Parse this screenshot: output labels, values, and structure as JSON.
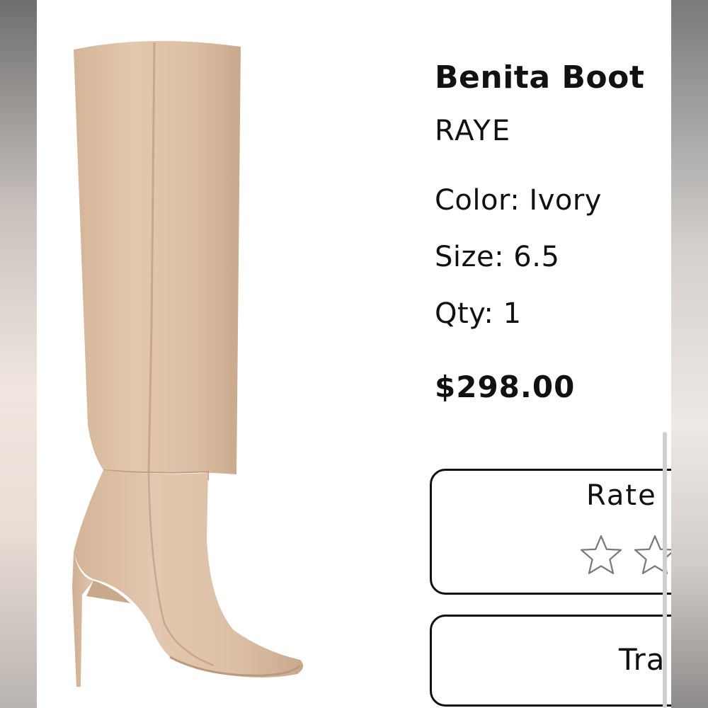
{
  "product": {
    "name": "Benita Boot",
    "brand": "RAYE",
    "color_line": "Color: Ivory",
    "size_line": "Size: 6.5",
    "qty_line": "Qty: 1",
    "price": "$298.00",
    "image_icon": "boot-product-image"
  },
  "rating": {
    "label": "Rate",
    "star_icon": "star-outline-icon"
  },
  "tracking": {
    "label": "Tra"
  },
  "colors": {
    "suede": "#dcc0a6",
    "text": "#111111",
    "border": "#111111"
  }
}
